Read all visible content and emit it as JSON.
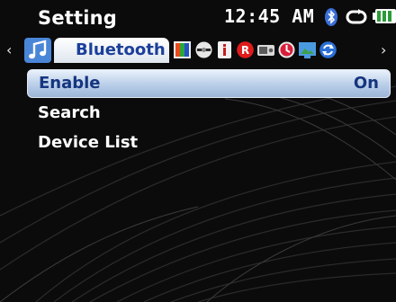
{
  "status_bar": {
    "title": "Setting",
    "time": "12:45 AM",
    "icons": [
      "bluetooth-icon",
      "repeat-icon",
      "battery-icon"
    ]
  },
  "tabs": {
    "active_label": "Bluetooth",
    "active_icon": "music-note-icon",
    "left_arrow": "‹",
    "right_arrow": "›",
    "other_icons": [
      "display-icon",
      "disc-icon",
      "info-icon",
      "record-icon",
      "radio-icon",
      "clock-icon",
      "picture-icon",
      "sync-icon"
    ]
  },
  "menu": {
    "items": [
      {
        "label": "Enable",
        "value": "On",
        "selected": true
      },
      {
        "label": "Search",
        "value": "",
        "selected": false
      },
      {
        "label": "Device List",
        "value": "",
        "selected": false
      }
    ]
  },
  "colors": {
    "background": "#0b0b0b",
    "tab_text": "#1b3f9a",
    "highlight": "#b9cee8"
  }
}
